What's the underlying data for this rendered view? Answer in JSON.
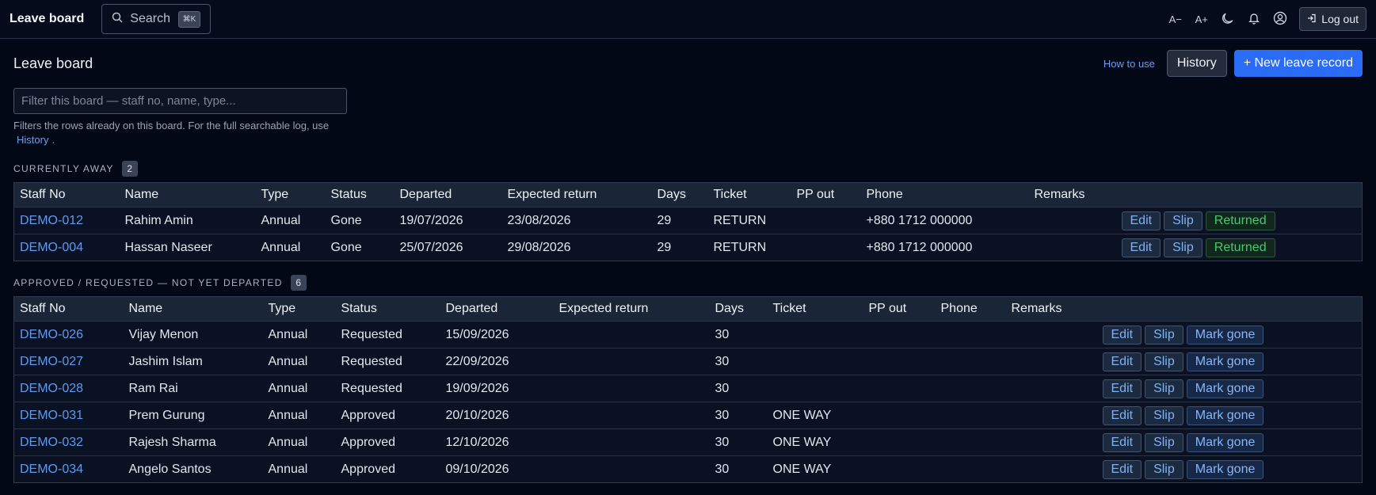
{
  "topbar": {
    "brand": "Leave board",
    "search_label": "Search",
    "search_shortcut": "⌘K",
    "font_decrease": "A−",
    "font_increase": "A+",
    "logout_label": "Log out"
  },
  "page": {
    "title": "Leave board",
    "how_to_use": "How to use",
    "history_button": "History",
    "new_record_button": "+ New leave record",
    "filter_placeholder": "Filter this board — staff no, name, type...",
    "hint_before": "Filters the rows already on this board. For the full searchable log, use",
    "hint_link": "History",
    "hint_after": "."
  },
  "away": {
    "label": "CURRENTLY AWAY",
    "count": "2",
    "columns": [
      "Staff No",
      "Name",
      "Type",
      "Status",
      "Departed",
      "Expected return",
      "Days",
      "Ticket",
      "PP out",
      "Phone",
      "Remarks",
      ""
    ],
    "rows": [
      {
        "staff": "DEMO-012",
        "name": "Rahim Amin",
        "type": "Annual",
        "status": "Gone",
        "departed": "19/07/2026",
        "expected": "23/08/2026",
        "days": "29",
        "ticket": "RETURN",
        "pp": "",
        "phone": "+880 1712 000000",
        "remarks": ""
      },
      {
        "staff": "DEMO-004",
        "name": "Hassan Naseer",
        "type": "Annual",
        "status": "Gone",
        "departed": "25/07/2026",
        "expected": "29/08/2026",
        "days": "29",
        "ticket": "RETURN",
        "pp": "",
        "phone": "+880 1712 000000",
        "remarks": ""
      }
    ],
    "actions": {
      "edit": "Edit",
      "slip": "Slip",
      "returned": "Returned"
    }
  },
  "pending": {
    "label": "APPROVED / REQUESTED — NOT YET DEPARTED",
    "count": "6",
    "columns": [
      "Staff No",
      "Name",
      "Type",
      "Status",
      "Departed",
      "Expected return",
      "Days",
      "Ticket",
      "PP out",
      "Phone",
      "Remarks",
      ""
    ],
    "rows": [
      {
        "staff": "DEMO-026",
        "name": "Vijay Menon",
        "type": "Annual",
        "status": "Requested",
        "departed": "15/09/2026",
        "expected": "",
        "days": "30",
        "ticket": "",
        "pp": "",
        "phone": "",
        "remarks": ""
      },
      {
        "staff": "DEMO-027",
        "name": "Jashim Islam",
        "type": "Annual",
        "status": "Requested",
        "departed": "22/09/2026",
        "expected": "",
        "days": "30",
        "ticket": "",
        "pp": "",
        "phone": "",
        "remarks": ""
      },
      {
        "staff": "DEMO-028",
        "name": "Ram Rai",
        "type": "Annual",
        "status": "Requested",
        "departed": "19/09/2026",
        "expected": "",
        "days": "30",
        "ticket": "",
        "pp": "",
        "phone": "",
        "remarks": ""
      },
      {
        "staff": "DEMO-031",
        "name": "Prem Gurung",
        "type": "Annual",
        "status": "Approved",
        "departed": "20/10/2026",
        "expected": "",
        "days": "30",
        "ticket": "ONE WAY",
        "pp": "",
        "phone": "",
        "remarks": ""
      },
      {
        "staff": "DEMO-032",
        "name": "Rajesh Sharma",
        "type": "Annual",
        "status": "Approved",
        "departed": "12/10/2026",
        "expected": "",
        "days": "30",
        "ticket": "ONE WAY",
        "pp": "",
        "phone": "",
        "remarks": ""
      },
      {
        "staff": "DEMO-034",
        "name": "Angelo Santos",
        "type": "Annual",
        "status": "Approved",
        "departed": "09/10/2026",
        "expected": "",
        "days": "30",
        "ticket": "ONE WAY",
        "pp": "",
        "phone": "",
        "remarks": ""
      }
    ],
    "actions": {
      "edit": "Edit",
      "slip": "Slip",
      "mark_gone": "Mark gone"
    }
  }
}
